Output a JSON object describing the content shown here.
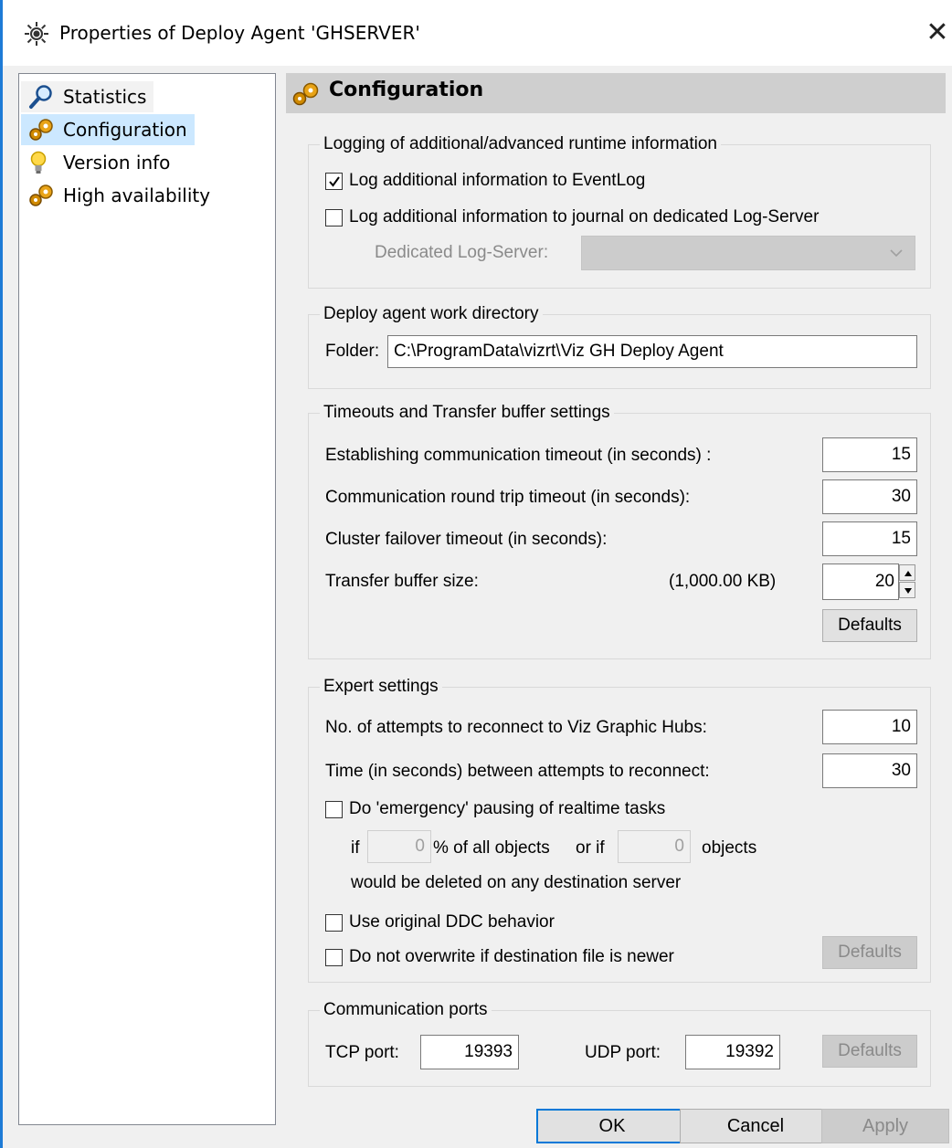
{
  "window": {
    "title": "Properties of Deploy Agent 'GHSERVER'",
    "close_label": "✕",
    "title_icon": "gear-icon",
    "accent_color": "#1e7bd6"
  },
  "nav": {
    "items": [
      {
        "label": "Statistics",
        "icon": "magnifier-icon"
      },
      {
        "label": "Configuration",
        "icon": "gears-icon",
        "selected": true
      },
      {
        "label": "Version info",
        "icon": "lightbulb-icon"
      },
      {
        "label": "High availability",
        "icon": "gears-icon"
      }
    ],
    "selected_color": "#cce8ff"
  },
  "panel": {
    "title": "Configuration",
    "icon": "gears-icon"
  },
  "logging": {
    "title": "Logging of additional/advanced runtime information",
    "eventlog_label": "Log additional information to EventLog",
    "eventlog_checked": true,
    "journal_label": "Log additional information to journal on dedicated Log-Server",
    "journal_checked": false,
    "logserver_label": "Dedicated Log-Server:",
    "logserver_value": ""
  },
  "workdir": {
    "title": "Deploy agent work directory",
    "folder_label": "Folder:",
    "folder_value": "C:\\ProgramData\\vizrt\\Viz GH Deploy Agent"
  },
  "timeouts": {
    "title": "Timeouts and Transfer buffer settings",
    "establishing_label": "Establishing communication timeout (in seconds) :",
    "establishing_value": "15",
    "roundtrip_label": "Communication round trip timeout (in seconds):",
    "roundtrip_value": "30",
    "failover_label": "Cluster failover timeout (in seconds):",
    "failover_value": "15",
    "buffer_label": "Transfer buffer size:",
    "buffer_size_display": "(1,000.00 KB)",
    "buffer_value": "20",
    "defaults_label": "Defaults"
  },
  "expert": {
    "title": "Expert settings",
    "reconnect_attempts_label": "No. of attempts to reconnect to Viz Graphic Hubs:",
    "reconnect_attempts_value": "10",
    "reconnect_interval_label": "Time (in seconds) between attempts to reconnect:",
    "reconnect_interval_value": "30",
    "emergency_label": "Do 'emergency' pausing of realtime tasks",
    "emergency_checked": false,
    "if_label": "if",
    "percent_value": "0",
    "percent_label": "% of all objects",
    "or_if_label": "or if",
    "objects_value": "0",
    "objects_label": "objects",
    "deleted_label": "would be deleted on any destination server",
    "ddc_label": "Use original DDC behavior",
    "ddc_checked": false,
    "overwrite_label": "Do not overwrite if destination file is newer",
    "overwrite_checked": false,
    "defaults_label": "Defaults"
  },
  "ports": {
    "title": "Communication ports",
    "tcp_label": "TCP port:",
    "tcp_value": "19393",
    "udp_label": "UDP port:",
    "udp_value": "19392",
    "defaults_label": "Defaults"
  },
  "footer": {
    "ok_label": "OK",
    "cancel_label": "Cancel",
    "apply_label": "Apply",
    "ok_border_color": "#0078d7"
  }
}
